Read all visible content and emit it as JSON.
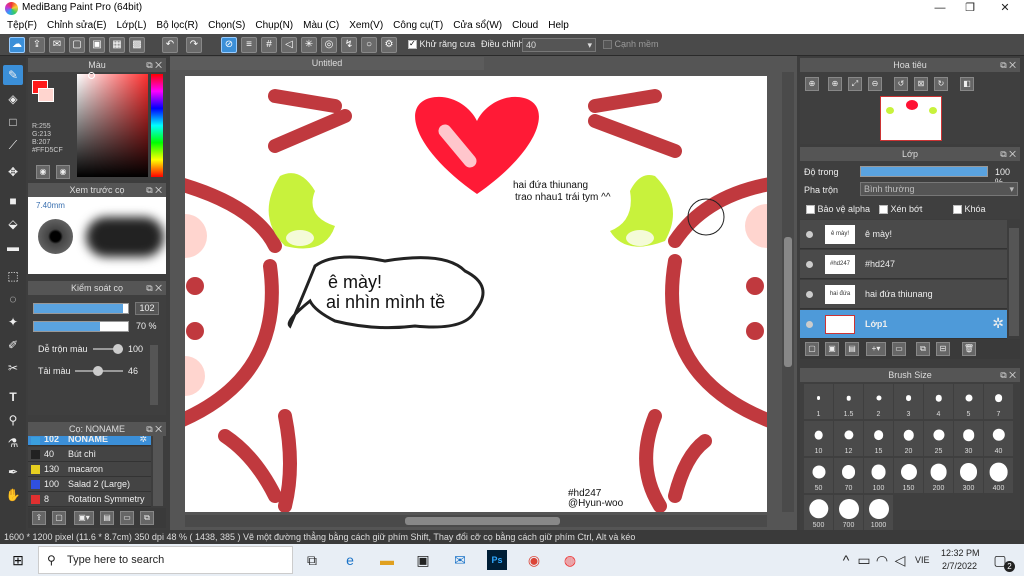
{
  "window": {
    "title": "MediBang Paint Pro (64bit)",
    "minimize": "—",
    "maximize": "❐",
    "close": "✕"
  },
  "menu": [
    "Tệp(F)",
    "Chỉnh sửa(E)",
    "Lớp(L)",
    "Bộ lọc(R)",
    "Chọn(S)",
    "Chụp(N)",
    "Màu (C)",
    "Xem(V)",
    "Công cụ(T)",
    "Cửa sổ(W)",
    "Cloud",
    "Help"
  ],
  "toolbar": {
    "antialias_label": "Khử răng cưa",
    "adjust_label": "Điều chỉnh",
    "adjust_value": "40",
    "smooth_label": "Cạnh mềm"
  },
  "color_panel": {
    "title": "Màu",
    "r": "R:255",
    "g": "G:213",
    "b": "B:207",
    "hex": "#FFD5CF"
  },
  "brush_preview": {
    "title": "Xem trước cọ",
    "size": "7.40mm"
  },
  "brush_control": {
    "title": "Kiểm soát cọ",
    "size_value": "102",
    "size_fill": 0.95,
    "opacity_value": "70 %",
    "opacity_fill": 0.7,
    "mix_label": "Dễ trộn màu",
    "mix_value": "100",
    "amount_label": "Tải màu",
    "amount_value": "46"
  },
  "brush_list": {
    "title": "Cọ: NONAME",
    "items": [
      {
        "num": "102",
        "name": "NONAME",
        "color": "#3aa0e0"
      },
      {
        "num": "40",
        "name": "Bút chì",
        "color": "#222222"
      },
      {
        "num": "130",
        "name": "macaron",
        "color": "#e8d020"
      },
      {
        "num": "100",
        "name": "Salad 2 (Large)",
        "color": "#3050e0"
      },
      {
        "num": "8",
        "name": "Rotation Symmetry",
        "color": "#e03030"
      }
    ]
  },
  "canvas": {
    "tab": "Untitled",
    "text_top": "hai đứa thiunang",
    "text_top2": "trao nhau1 trái tym ^^",
    "bubble1": "ê mày!",
    "bubble2": "ai nhìn mình tề",
    "tag": "#hd247",
    "handle": "@Hyun-woo"
  },
  "navigator": {
    "title": "Hoa tiêu"
  },
  "layer_panel": {
    "title": "Lớp",
    "opacity_label": "Độ trong",
    "opacity_value": "100 %",
    "blend_label": "Pha trộn",
    "blend_value": "Bình thường",
    "protect_alpha": "Bảo vệ alpha",
    "clipping": "Xén bớt",
    "lock": "Khóa",
    "layers": [
      {
        "name": "ê mày!",
        "thumb": "ê mày!"
      },
      {
        "name": "#hd247",
        "thumb": "#hd247"
      },
      {
        "name": "hai đứa thiunang",
        "thumb": "hai đứa"
      },
      {
        "name": "Lớp1",
        "thumb": ""
      }
    ]
  },
  "brush_size": {
    "title": "Brush Size",
    "sizes": [
      "1",
      "1.5",
      "2",
      "3",
      "4",
      "5",
      "7",
      "10",
      "12",
      "15",
      "20",
      "25",
      "30",
      "40",
      "50",
      "70",
      "100",
      "150",
      "200",
      "300",
      "400",
      "500",
      "700",
      "1000"
    ]
  },
  "status": {
    "text": "1600 * 1200 pixel   (11.6 * 8.7cm)   350 dpi   48 %   ( 1438, 385 )   Vẽ một đường thẳng bằng cách giữ phím Shift, Thay đổi cỡ cọ bằng cách giữ phím Ctrl, Alt và kéo"
  },
  "taskbar": {
    "search": "Type here to search",
    "time": "12:32 PM",
    "date": "2/7/2022",
    "lang": "VIE",
    "notif": "2"
  }
}
